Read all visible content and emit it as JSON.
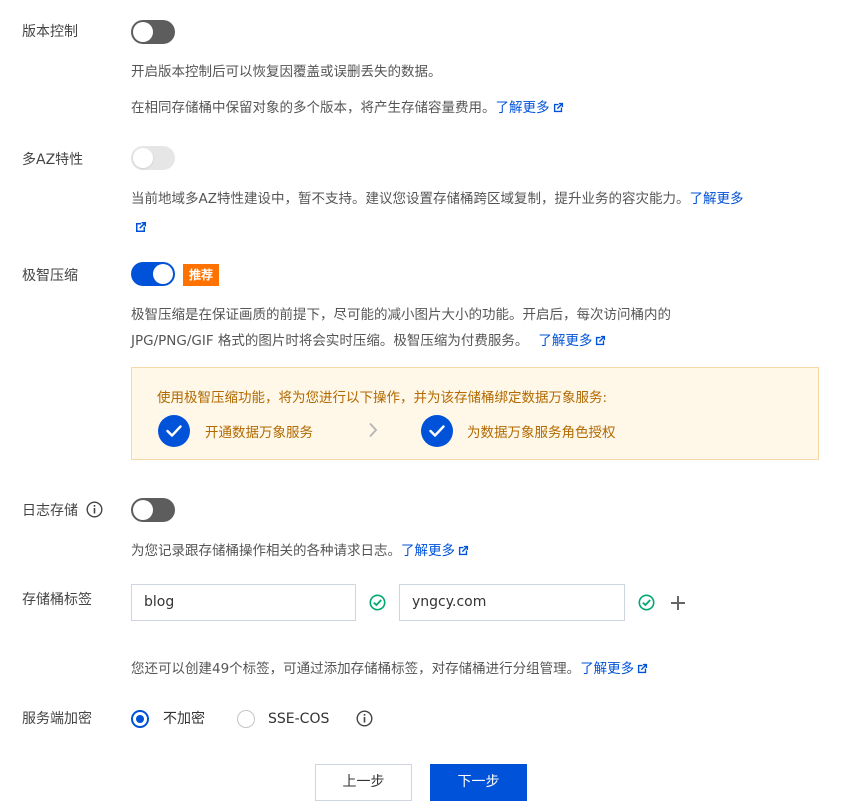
{
  "versioning": {
    "label": "版本控制",
    "desc1": "开启版本控制后可以恢复因覆盖或误删丢失的数据。",
    "desc2": "在相同存储桶中保留对象的多个版本，将产生存储容量费用。",
    "learn_more": "了解更多",
    "enabled": false
  },
  "multi_az": {
    "label": "多AZ特性",
    "desc": "当前地域多AZ特性建设中，暂不支持。建议您设置存储桶跨区域复制，提升业务的容灾能力。",
    "learn_more": "了解更多",
    "enabled": false,
    "disabled": true
  },
  "compression": {
    "label": "极智压缩",
    "badge": "推荐",
    "desc1": "极智压缩是在保证画质的前提下，尽可能的减小图片大小的功能。开启后，每次访问桶内的",
    "desc2": "JPG/PNG/GIF 格式的图片时将会实时压缩。极智压缩为付费服务。",
    "learn_more": "了解更多",
    "enabled": true,
    "notice": {
      "text": "使用极智压缩功能，将为您进行以下操作，并为该存储桶绑定数据万象服务:",
      "step1": "开通数据万象服务",
      "step2": "为数据万象服务角色授权"
    }
  },
  "logging": {
    "label": "日志存储",
    "desc": "为您记录跟存储桶操作相关的各种请求日志。",
    "learn_more": "了解更多",
    "enabled": false
  },
  "tags": {
    "label": "存储桶标签",
    "key_value": "blog",
    "value_value": "yngcy.com",
    "desc": "您还可以创建49个标签，可通过添加存储桶标签，对存储桶进行分组管理。",
    "learn_more": "了解更多"
  },
  "encryption": {
    "label": "服务端加密",
    "option1": "不加密",
    "option2": "SSE-COS",
    "selected": "不加密"
  },
  "footer": {
    "prev_label": "上一步",
    "next_label": "下一步"
  },
  "colors": {
    "primary": "#0052d9",
    "badge": "#ff7200",
    "success": "#00a870"
  }
}
